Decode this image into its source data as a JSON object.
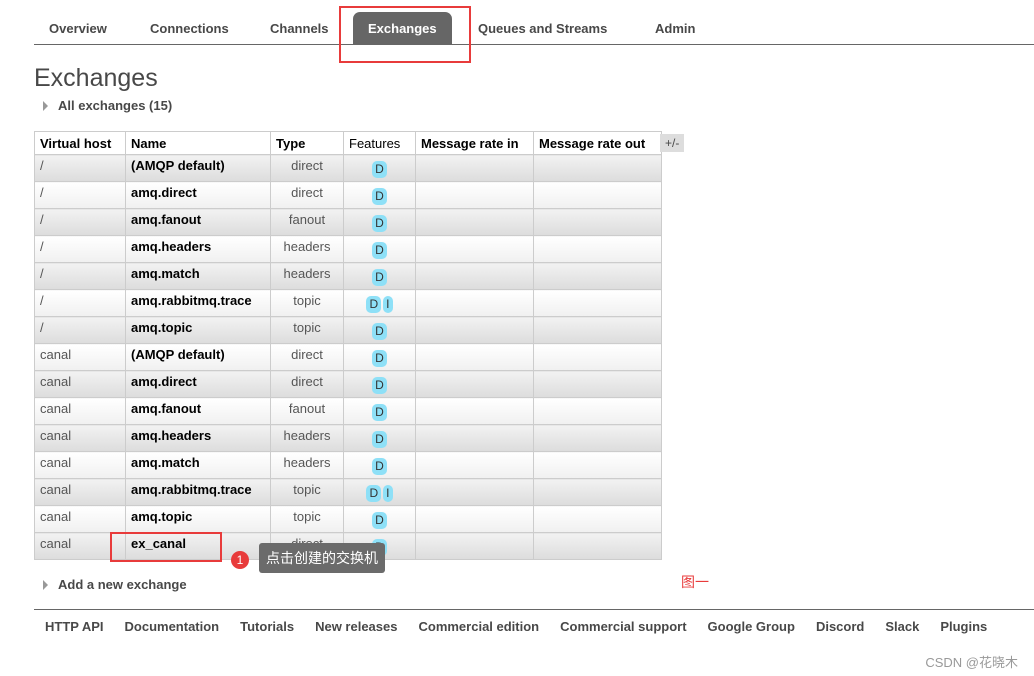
{
  "nav": {
    "tabs": [
      "Overview",
      "Connections",
      "Channels",
      "Exchanges",
      "Queues and Streams",
      "Admin"
    ],
    "active": "Exchanges"
  },
  "page_title": "Exchanges",
  "all_exchanges": "All exchanges (15)",
  "table": {
    "headers": [
      "Virtual host",
      "Name",
      "Type",
      "Features",
      "Message rate in",
      "Message rate out"
    ],
    "toggle": "+/-",
    "rows": [
      [
        "/",
        "(AMQP default)",
        "direct",
        [
          "D"
        ]
      ],
      [
        "/",
        "amq.direct",
        "direct",
        [
          "D"
        ]
      ],
      [
        "/",
        "amq.fanout",
        "fanout",
        [
          "D"
        ]
      ],
      [
        "/",
        "amq.headers",
        "headers",
        [
          "D"
        ]
      ],
      [
        "/",
        "amq.match",
        "headers",
        [
          "D"
        ]
      ],
      [
        "/",
        "amq.rabbitmq.trace",
        "topic",
        [
          "D",
          "I"
        ]
      ],
      [
        "/",
        "amq.topic",
        "topic",
        [
          "D"
        ]
      ],
      [
        "canal",
        "(AMQP default)",
        "direct",
        [
          "D"
        ]
      ],
      [
        "canal",
        "amq.direct",
        "direct",
        [
          "D"
        ]
      ],
      [
        "canal",
        "amq.fanout",
        "fanout",
        [
          "D"
        ]
      ],
      [
        "canal",
        "amq.headers",
        "headers",
        [
          "D"
        ]
      ],
      [
        "canal",
        "amq.match",
        "headers",
        [
          "D"
        ]
      ],
      [
        "canal",
        "amq.rabbitmq.trace",
        "topic",
        [
          "D",
          "I"
        ]
      ],
      [
        "canal",
        "amq.topic",
        "topic",
        [
          "D"
        ]
      ],
      [
        "canal",
        "ex_canal",
        "direct",
        [
          "D"
        ]
      ]
    ]
  },
  "annotation": {
    "number": "1",
    "text": "点击创建的交换机",
    "figure_label": "图一"
  },
  "add_exchange": "Add a new exchange",
  "footer": [
    "HTTP API",
    "Documentation",
    "Tutorials",
    "New releases",
    "Commercial edition",
    "Commercial support",
    "Google Group",
    "Discord",
    "Slack",
    "Plugins"
  ],
  "watermark": "CSDN @花晓木",
  "colors": {
    "active_tab": "#666666",
    "badge": "#8ee0f7",
    "highlight": "#e83b3b"
  }
}
